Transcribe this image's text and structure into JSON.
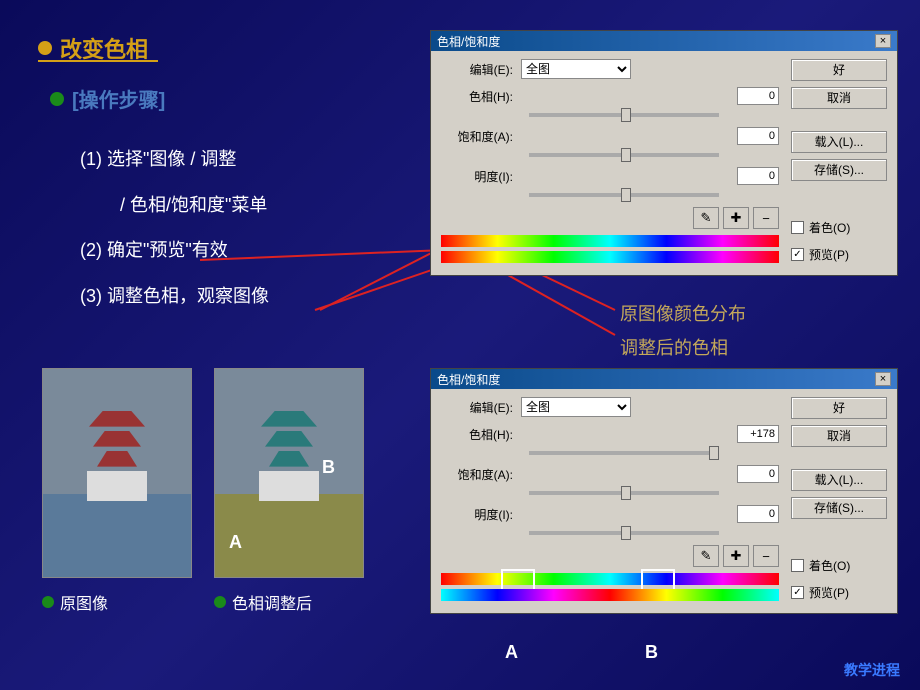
{
  "heading": "改变色相",
  "sub_heading": "[操作步骤]",
  "steps": {
    "s1a": "(1) 选择\"图像 / 调整",
    "s1b": "/ 色相/饱和度\"菜单",
    "s2": "(2) 确定\"预览\"有效",
    "s3": "(3) 调整色相，观察图像"
  },
  "annotations": {
    "line1": "原图像颜色分布",
    "line2": "调整后的色相"
  },
  "img_labels": {
    "left": "原图像",
    "right": "色相调整后"
  },
  "overlay": {
    "a": "A",
    "b": "B"
  },
  "dialog": {
    "title": "色相/饱和度",
    "edit_label": "编辑(E):",
    "edit_value": "全图",
    "hue_label": "色相(H):",
    "sat_label": "饱和度(A):",
    "light_label": "明度(I):",
    "hue_val_top": "0",
    "hue_val_bottom": "+178",
    "sat_val": "0",
    "light_val": "0",
    "ok": "好",
    "cancel": "取消",
    "load": "载入(L)...",
    "save": "存储(S)...",
    "colorize": "着色(O)",
    "preview": "预览(P)"
  },
  "ab": {
    "a": "A",
    "b": "B"
  },
  "footer": "教学进程"
}
